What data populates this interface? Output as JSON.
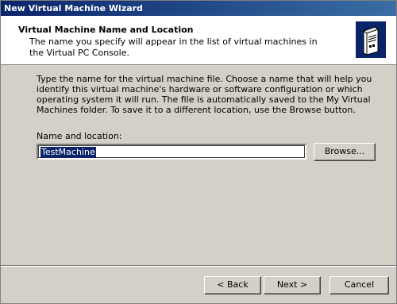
{
  "window": {
    "title": "New Virtual Machine Wizard"
  },
  "header": {
    "title": "Virtual Machine Name and Location",
    "subtitle": "The name you specify will appear in the list of virtual machines in the Virtual PC Console.",
    "icon": "server-computer-icon"
  },
  "content": {
    "description": "Type the name for the virtual machine file. Choose a name that will help you identify this virtual machine's hardware or software configuration or which operating system it will run. The file is automatically saved to the My Virtual Machines folder. To save it to a different location, use the Browse button.",
    "field_label": "Name and location:",
    "field_value": "TestMachine",
    "browse_label": "Browse..."
  },
  "footer": {
    "back_label": "< Back",
    "next_label": "Next >",
    "cancel_label": "Cancel"
  },
  "colors": {
    "titlebar_start": "#0a246a",
    "titlebar_end": "#3a6ea5",
    "face": "#d4d0c8",
    "selection": "#0a246a"
  }
}
